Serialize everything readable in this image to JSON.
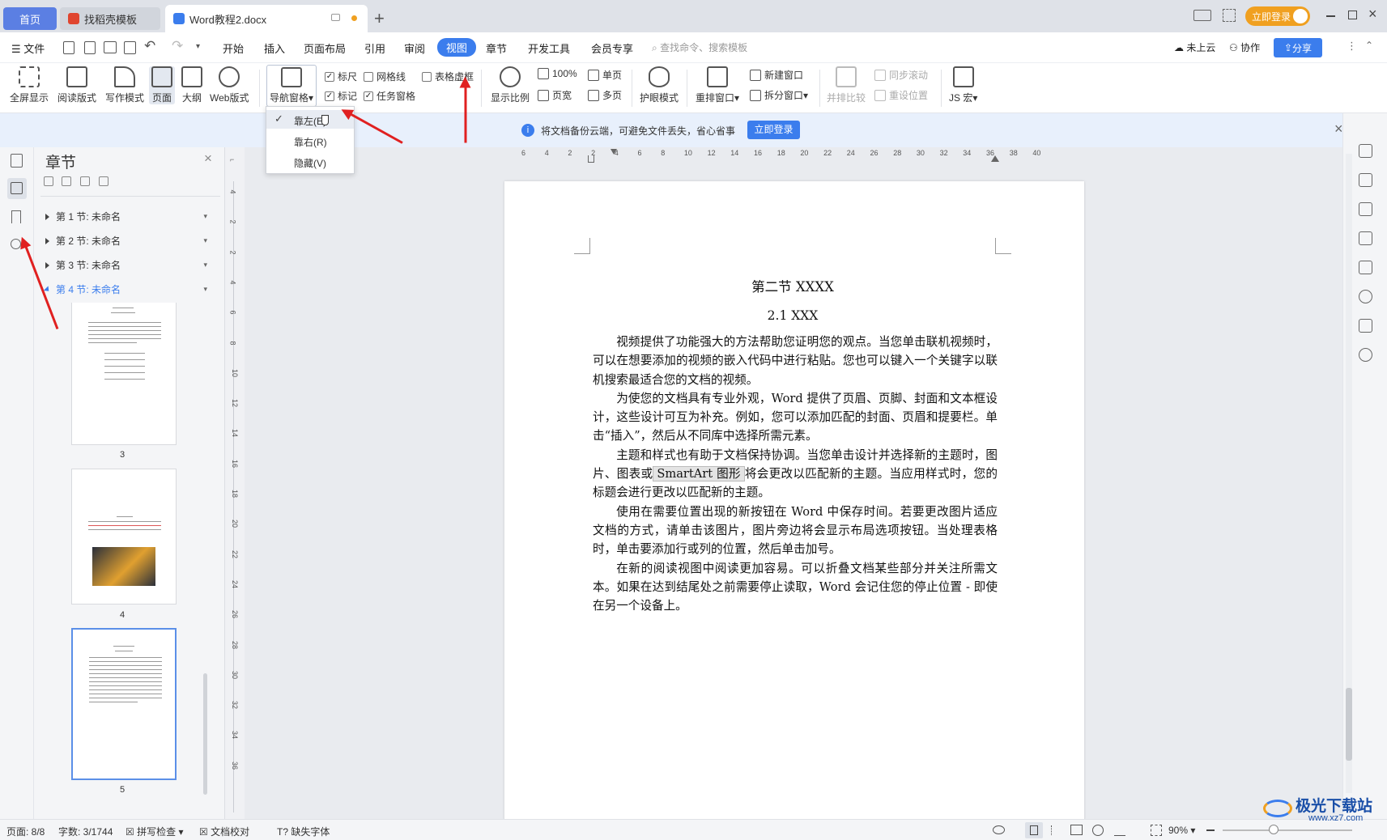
{
  "tabs": {
    "home": "首页",
    "template": "找稻壳模板",
    "doc": "Word教程2.docx"
  },
  "window": {
    "login": "立即登录"
  },
  "menu": {
    "file": "文件",
    "items": [
      "开始",
      "插入",
      "页面布局",
      "引用",
      "审阅",
      "视图",
      "章节",
      "开发工具",
      "会员专享"
    ],
    "search_placeholder": "查找命令、搜索模板",
    "cloud": "未上云",
    "collab": "协作",
    "share": "分享"
  },
  "ribbon": {
    "fullscreen": "全屏显示",
    "reading": "阅读版式",
    "writing": "写作模式",
    "page": "页面",
    "outline": "大纲",
    "web": "Web版式",
    "nav_pane": "导航窗格",
    "ruler": "标尺",
    "gridlines": "网格线",
    "table_grid": "表格虚框",
    "marks": "标记",
    "task_pane": "任务窗格",
    "zoom": "显示比例",
    "hundred": "100%",
    "page_width": "页宽",
    "single": "单页",
    "multi": "多页",
    "eye": "护眼模式",
    "rearrange": "重排窗口",
    "new_window": "新建窗口",
    "split": "拆分窗口",
    "compare": "并排比较",
    "sync_scroll": "同步滚动",
    "reset_pos": "重设位置",
    "js_macro": "JS 宏"
  },
  "dropdown": {
    "left": "靠左(E)",
    "right": "靠右(R)",
    "hide": "隐藏(V)"
  },
  "notice": {
    "text": "将文档备份云端，可避免文件丢失，省心省事",
    "button": "立即登录"
  },
  "nav": {
    "title": "章节",
    "sections": [
      "第 1 节: 未命名",
      "第 2 节: 未命名",
      "第 3 节: 未命名",
      "第 4 节: 未命名"
    ],
    "page_numbers": [
      "3",
      "4",
      "5"
    ]
  },
  "ruler": {
    "h_ticks": [
      "6",
      "4",
      "2",
      "2",
      "4",
      "6",
      "8",
      "10",
      "12",
      "14",
      "16",
      "18",
      "20",
      "22",
      "24",
      "26",
      "28",
      "30",
      "32",
      "34",
      "36",
      "38",
      "40"
    ],
    "v_ticks": [
      "4",
      "2",
      "2",
      "4",
      "6",
      "8",
      "10",
      "12",
      "14",
      "16",
      "18",
      "20",
      "22",
      "24",
      "26",
      "28",
      "30",
      "32",
      "34",
      "36"
    ]
  },
  "document": {
    "heading1": "第二节 XXXX",
    "heading2": "2.1 XXX",
    "p1": "视频提供了功能强大的方法帮助您证明您的观点。当您单击联机视频时，可以在想要添加的视频的嵌入代码中进行粘贴。您也可以键入一个关键字以联机搜索最适合您的文档的视频。",
    "p2": "为使您的文档具有专业外观，Word 提供了页眉、页脚、封面和文本框设计，这些设计可互为补充。例如，您可以添加匹配的封面、页眉和提要栏。单击“插入”，然后从不同库中选择所需元素。",
    "p3a": "主题和样式也有助于文档保持协调。当您单击设计并选择新的主题时，图片、图表或",
    "p3b": "SmartArt 图形",
    "p3c": "将会更改以匹配新的主题。当应用样式时，您的标题会进行更改以匹配新的主题。",
    "p4": "使用在需要位置出现的新按钮在 Word 中保存时间。若要更改图片适应文档的方式，请单击该图片，图片旁边将会显示布局选项按钮。当处理表格时，单击要添加行或列的位置，然后单击加号。",
    "p5": "在新的阅读视图中阅读更加容易。可以折叠文档某些部分并关注所需文本。如果在达到结尾处之前需要停止读取，Word 会记住您的停止位置 - 即使在另一个设备上。"
  },
  "status": {
    "page": "页面: 8/8",
    "words": "字数: 3/1744",
    "spell": "拼写检查",
    "proof": "文档校对",
    "missing_font": "缺失字体",
    "zoom": "90%"
  },
  "watermark": {
    "name": "极光下载站",
    "url": "www.xz7.com"
  },
  "colors": {
    "accent": "#3b7ded",
    "arrow": "#e02020",
    "login": "#f0a020"
  }
}
